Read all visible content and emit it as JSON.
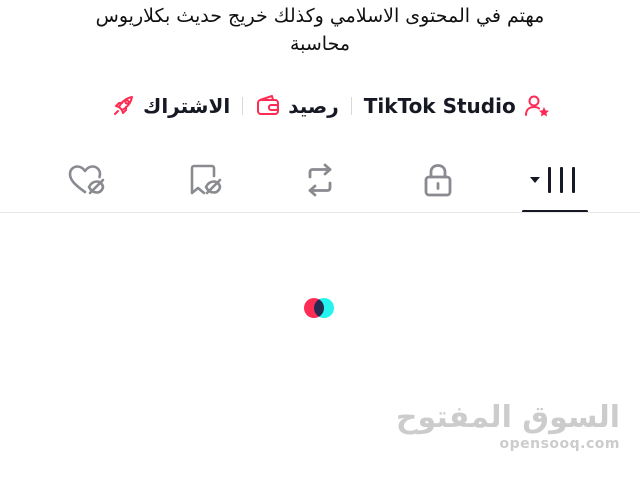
{
  "profile": {
    "bio_line_1": "مهتم في المحتوى الاسلامي وكذلك خريج حديث بكلاريوس",
    "bio_line_2": "محاسبة"
  },
  "links": {
    "studio_label": "TikTok Studio",
    "balance_label": "رصيد",
    "subscription_label": "الاشتراك"
  },
  "tabs": [
    {
      "icon": "liked-hidden-icon"
    },
    {
      "icon": "favorites-hidden-icon"
    },
    {
      "icon": "repost-icon"
    },
    {
      "icon": "lock-icon"
    },
    {
      "icon": "grid-videos-icon",
      "selected": true
    }
  ],
  "watermark": {
    "arabic": "السوق المفتوح",
    "latin": "opensooq.com"
  },
  "colors": {
    "accent_red": "#fe2c55",
    "accent_cyan": "#25f4ee",
    "text": "#161823",
    "icon_gray": "#8a8b91"
  }
}
